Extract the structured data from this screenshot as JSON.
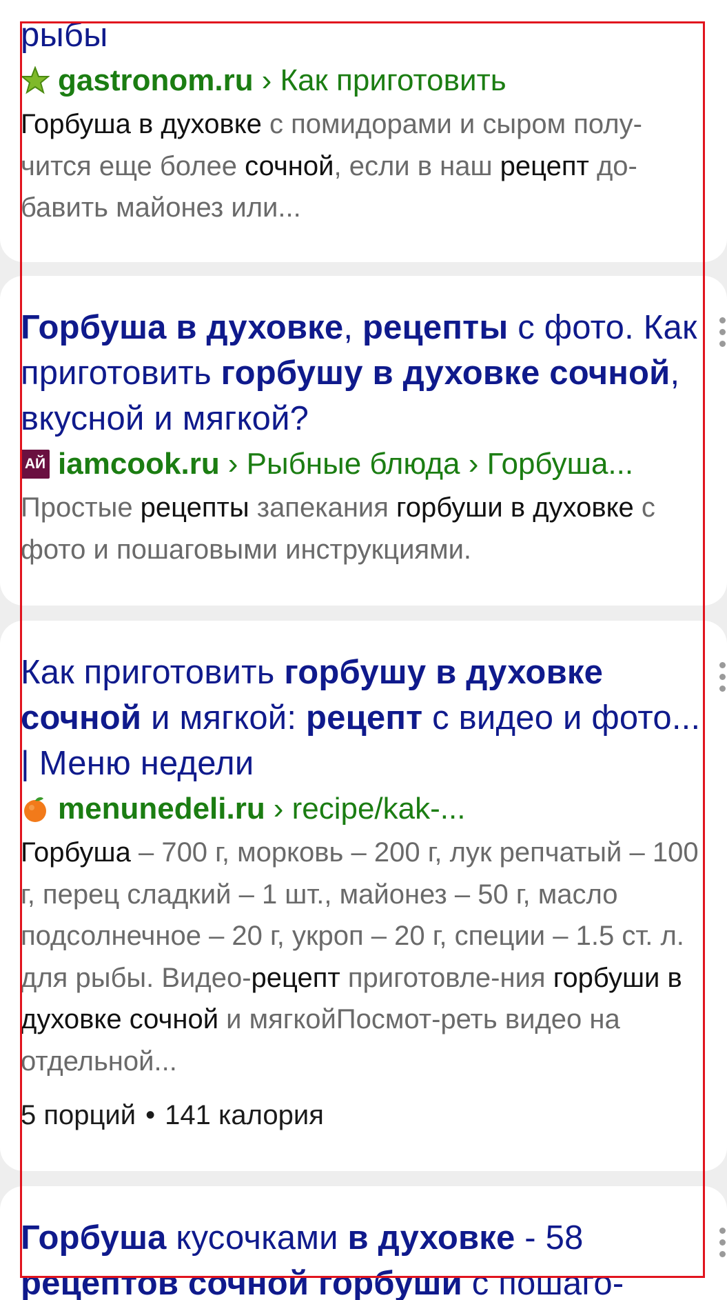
{
  "results": [
    {
      "title_tail": "рыбы",
      "domain": "gastronom.ru",
      "path": "› Как приготовить",
      "snippet": [
        {
          "t": "Горбуша в духовке",
          "h": true
        },
        {
          "t": " с помидорами и сыром полу-чится еще более ",
          "h": false
        },
        {
          "t": "сочной",
          "h": true
        },
        {
          "t": ", если в наш ",
          "h": false
        },
        {
          "t": "рецепт",
          "h": true
        },
        {
          "t": " до-бавить майонез или...",
          "h": false
        }
      ]
    },
    {
      "title": [
        {
          "t": "Горбуша в духовке",
          "b": true
        },
        {
          "t": ", ",
          "b": false
        },
        {
          "t": "рецепты",
          "b": true
        },
        {
          "t": " с фото. Как приготовить ",
          "b": false
        },
        {
          "t": "горбушу в духовке сочной",
          "b": true
        },
        {
          "t": ", вкусной и мягкой?",
          "b": false
        }
      ],
      "domain": "iamcook.ru",
      "path": "› Рыбные блюда › Горбуша...",
      "favicon_text": "АЙ",
      "snippet": [
        {
          "t": "Простые ",
          "h": false
        },
        {
          "t": "рецепты",
          "h": true
        },
        {
          "t": " запекания ",
          "h": false
        },
        {
          "t": "горбуши в духовке",
          "h": true
        },
        {
          "t": " с фото и пошаговыми инструкциями.",
          "h": false
        }
      ]
    },
    {
      "title": [
        {
          "t": "Как приготовить ",
          "b": false
        },
        {
          "t": "горбушу в духовке сочной",
          "b": true
        },
        {
          "t": " и мягкой: ",
          "b": false
        },
        {
          "t": "рецепт",
          "b": true
        },
        {
          "t": " с видео и фото... | Меню недели",
          "b": false
        }
      ],
      "domain": "menunedeli.ru",
      "path": "› recipe/kak-...",
      "snippet": [
        {
          "t": "Горбуша",
          "h": true
        },
        {
          "t": " – 700 г, морковь – 200 г, лук репчатый – 100 г, перец сладкий – 1 шт., майонез – 50 г, масло подсолнечное – 20 г, укроп – 20 г, специи – 1.5 ст. л. для рыбы. Видео-",
          "h": false
        },
        {
          "t": "рецепт",
          "h": true
        },
        {
          "t": " приготовле-ния ",
          "h": false
        },
        {
          "t": "горбуши в духовке сочной",
          "h": true
        },
        {
          "t": " и мягкойПосмот-реть видео на отдельной...",
          "h": false
        }
      ],
      "servings": "5 порций",
      "separator": "•",
      "calories": "141 калория"
    },
    {
      "title": [
        {
          "t": "Горбуша",
          "b": true
        },
        {
          "t": " кусочками ",
          "b": false
        },
        {
          "t": "в духовке",
          "b": true
        },
        {
          "t": " - 58 ",
          "b": false
        },
        {
          "t": "рецептов сочной горбуши",
          "b": true
        },
        {
          "t": " с пошаго-",
          "b": false
        }
      ]
    }
  ],
  "colors": {
    "title": "#0f1a8c",
    "url": "#1b7d12",
    "snippet": "#6a6a6a",
    "highlight": "#111111",
    "page_bg": "#eeeeee",
    "frame": "#e1141e"
  },
  "icons": [
    "gastronom-star-icon",
    "iamcook-logo-icon",
    "orange-fruit-icon",
    "more-vertical-icon"
  ]
}
